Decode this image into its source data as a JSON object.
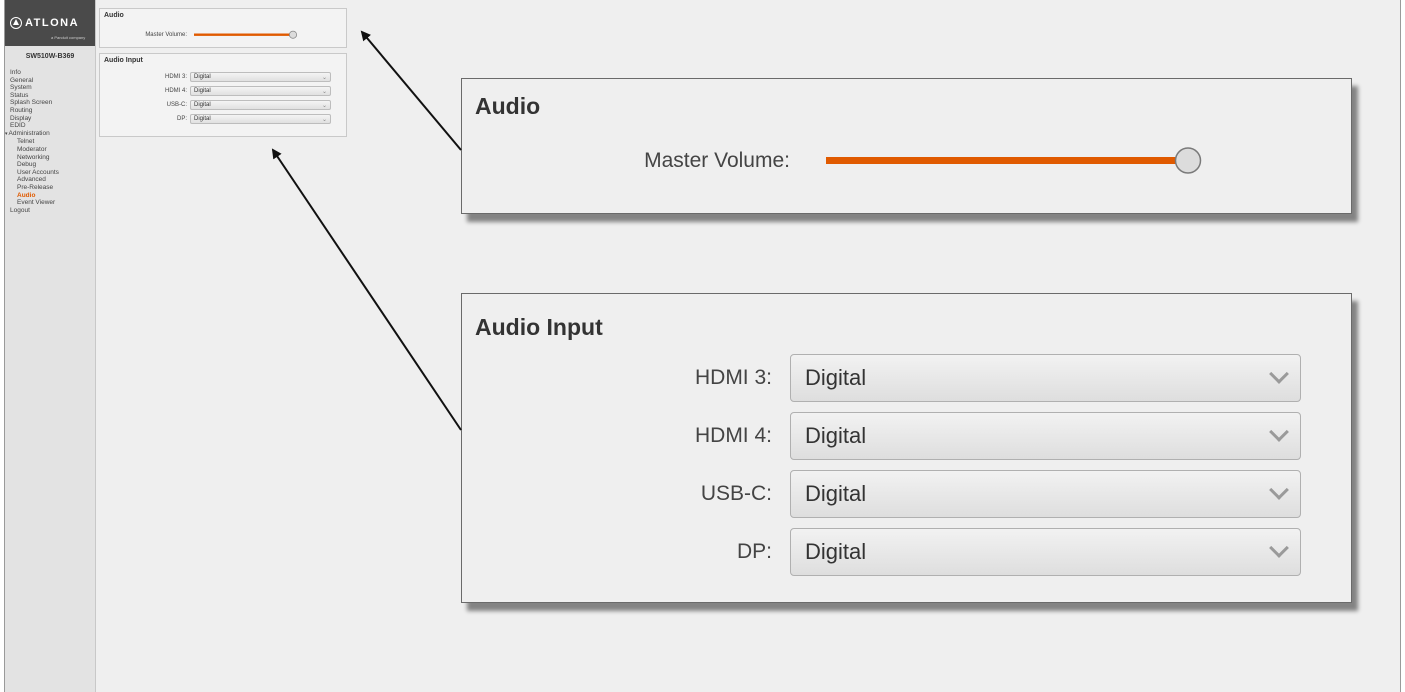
{
  "logo": {
    "brand": "ATLONA",
    "tagline": "a Panduit company"
  },
  "device_name": "SW510W-B369",
  "nav": [
    {
      "label": "Info",
      "level": 0,
      "active": false
    },
    {
      "label": "General",
      "level": 0,
      "active": false
    },
    {
      "label": "System",
      "level": 0,
      "active": false
    },
    {
      "label": "Status",
      "level": 0,
      "active": false
    },
    {
      "label": "Splash Screen",
      "level": 0,
      "active": false
    },
    {
      "label": "Routing",
      "level": 0,
      "active": false
    },
    {
      "label": "Display",
      "level": 0,
      "active": false
    },
    {
      "label": "EDID",
      "level": 0,
      "active": false
    },
    {
      "label": "Administration",
      "level": 0,
      "active": false,
      "expanded": true
    },
    {
      "label": "Telnet",
      "level": 1,
      "active": false
    },
    {
      "label": "Moderator",
      "level": 1,
      "active": false
    },
    {
      "label": "Networking",
      "level": 1,
      "active": false
    },
    {
      "label": "Debug",
      "level": 1,
      "active": false
    },
    {
      "label": "User Accounts",
      "level": 1,
      "active": false
    },
    {
      "label": "Advanced",
      "level": 1,
      "active": false
    },
    {
      "label": "Pre-Release",
      "level": 1,
      "active": false
    },
    {
      "label": "Audio",
      "level": 1,
      "active": true
    },
    {
      "label": "Event Viewer",
      "level": 1,
      "active": false
    },
    {
      "label": "Logout",
      "level": 0,
      "active": false
    }
  ],
  "audio": {
    "title": "Audio",
    "master_volume_label": "Master Volume:",
    "master_volume_level": 1.0
  },
  "audio_input": {
    "title": "Audio Input",
    "rows": [
      {
        "label": "HDMI 3:",
        "value": "Digital"
      },
      {
        "label": "HDMI 4:",
        "value": "Digital"
      },
      {
        "label": "USB-C:",
        "value": "Digital"
      },
      {
        "label": "DP:",
        "value": "Digital"
      }
    ]
  },
  "colors": {
    "accent": "#e05a00",
    "slider_track": "#e05a00",
    "sidebar_bg": "#e3e3e3",
    "logo_bg": "#4a4a4a"
  },
  "icons": {
    "dropdown": "chevron-down-icon",
    "expand": "caret-down-icon",
    "logo": "atlona-logo-icon"
  }
}
